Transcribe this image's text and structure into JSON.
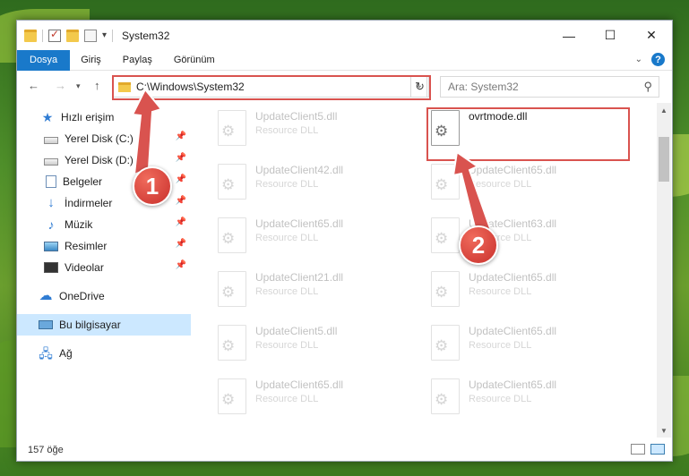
{
  "window": {
    "title": "System32",
    "controls": {
      "minimize": "—",
      "maximize": "☐",
      "close": "✕"
    }
  },
  "ribbon": {
    "tabs": [
      {
        "label": "Dosya",
        "active": true
      },
      {
        "label": "Giriş",
        "active": false
      },
      {
        "label": "Paylaş",
        "active": false
      },
      {
        "label": "Görünüm",
        "active": false
      }
    ],
    "help": "?"
  },
  "address": {
    "path": "C:\\Windows\\System32",
    "search_placeholder": "Ara: System32"
  },
  "sidebar": {
    "items": [
      {
        "label": "Hızlı erişim",
        "icon": "star-icon",
        "pinned": false
      },
      {
        "label": "Yerel Disk (C:)",
        "icon": "disk-icon",
        "pinned": true
      },
      {
        "label": "Yerel Disk (D:)",
        "icon": "disk-icon",
        "pinned": true
      },
      {
        "label": "Belgeler",
        "icon": "documents-icon",
        "pinned": true
      },
      {
        "label": "İndirmeler",
        "icon": "download-icon",
        "pinned": true
      },
      {
        "label": "Müzik",
        "icon": "music-icon",
        "pinned": true
      },
      {
        "label": "Resimler",
        "icon": "pictures-icon",
        "pinned": true
      },
      {
        "label": "Videolar",
        "icon": "video-icon",
        "pinned": true
      },
      {
        "label": "OneDrive",
        "icon": "cloud-icon",
        "pinned": false
      },
      {
        "label": "Bu bilgisayar",
        "icon": "computer-icon",
        "pinned": false,
        "selected": true
      },
      {
        "label": "Ağ",
        "icon": "network-icon",
        "pinned": false
      }
    ]
  },
  "files": {
    "highlighted": {
      "name": "ovrtmode.dll",
      "type": ""
    },
    "left_column": [
      {
        "name": "UpdateClient5.dll",
        "type": "Resource DLL"
      },
      {
        "name": "UpdateClient42.dll",
        "type": "Resource DLL"
      },
      {
        "name": "UpdateClient65.dll",
        "type": "Resource DLL"
      },
      {
        "name": "UpdateClient21.dll",
        "type": "Resource DLL"
      },
      {
        "name": "UpdateClient5.dll",
        "type": "Resource DLL"
      },
      {
        "name": "UpdateClient65.dll",
        "type": "Resource DLL"
      }
    ],
    "right_column": [
      {
        "name": "UpdateClient65.dll",
        "type": "Resource DLL"
      },
      {
        "name": "UpdateClient63.dll",
        "type": "Resource DLL"
      },
      {
        "name": "UpdateClient65.dll",
        "type": "Resource DLL"
      },
      {
        "name": "UpdateClient65.dll",
        "type": "Resource DLL"
      },
      {
        "name": "UpdateClient65.dll",
        "type": "Resource DLL"
      }
    ]
  },
  "status": {
    "count": "157 öğe"
  },
  "annotations": {
    "step1": "1",
    "step2": "2"
  },
  "colors": {
    "accent": "#1979ca",
    "annotation": "#d9534f",
    "selection": "#cce8ff"
  }
}
